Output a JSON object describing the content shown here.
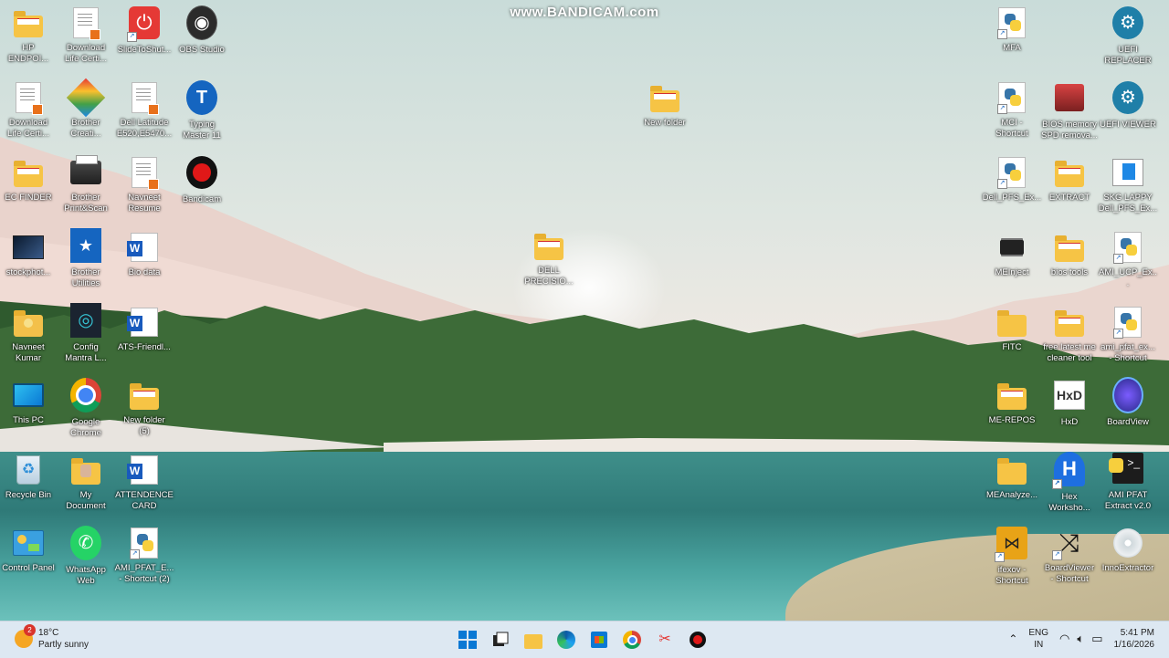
{
  "watermark": "www.BANDICAM.com",
  "icons": {
    "hp_endpoint": "HP\nENDPOI...",
    "download_life_1": "Download\nLife Certi...",
    "slide_to_shutdown": "SlideToShut...",
    "obs": "OBS Studio",
    "download_life_2": "Download\nLife Certi...",
    "brother_creati": "Brother\nCreati...",
    "dell_latitude": "Dell Latitude\nE520,E5470...",
    "typing_master": "Typing\nMaster 11",
    "ec_finder": "EC FINDER",
    "brother_print": "Brother\nPrint&Scan",
    "navneet_resume": "Navneet\nResume",
    "bandicam": "Bandicam",
    "stockphoto": "stockphot...",
    "brother_utilities": "Brother\nUtilities",
    "bio_data": "Bio data",
    "navneet_kumar": "Navneet\nKumar",
    "config_mantra": "Config\nMantra L...",
    "ats_friendly": "ATS-Friendl...",
    "this_pc": "This PC",
    "google_chrome": "Google\nChrome",
    "new_folder_5": "New folder\n(5)",
    "recycle_bin": "Recycle Bin",
    "my_document": "My\nDocument",
    "attendence_card": "ATTENDENCE\nCARD",
    "control_panel": "Control Panel",
    "whatsapp": "WhatsApp\nWeb",
    "ami_pfat_shortcut2": "AMI_PFAT_E...\n- Shortcut (2)",
    "new_folder_center": "New folder",
    "dell_precision": "DELL\nPRECISIO...",
    "mfa": "MFA",
    "uefi_replacer": "UEFI\nREPLACER",
    "mci_shortcut": "MCI -\nShortcut",
    "bios_memory": "BIOS memory\nSPD remova...",
    "uefi_viewer": "UEFI VIEWER",
    "dell_pfs_ex": "Dell_PFS_Ex...",
    "extract": "EXTRACT",
    "skg_lappy": "SKG LAPPY\nDell_PFS_Ex...",
    "me_inject": "MEInject",
    "bios_tools": "bios tools",
    "ami_ucp_ex": "AMI_UCP_Ex...",
    "fitc": "FITC",
    "free_latest_me": "free latest me\ncleaner tool",
    "ami_pfat_ex_shortcut": "ami_pfat_ex...\n- Shortcut",
    "me_repos": "ME-REPOS",
    "hxd": "HxD",
    "boardview": "BoardView",
    "meanalyze": "MEAnalyze...",
    "hex_workshop": "Hex\nWorksho...",
    "ami_pfat_extract": "AMI PFAT\nExtract v2.0",
    "ifexov_shortcut": "ifexov -\nShortcut",
    "boardviewer_shortcut": "BoardViewer\n- Shortcut",
    "innoextractor": "InnoExtractor"
  },
  "taskbar": {
    "weather_badge": "2",
    "temperature": "18°C",
    "condition": "Partly sunny",
    "lang_1": "ENG",
    "lang_2": "IN",
    "time": "5:41 PM",
    "date": "1/16/2026"
  }
}
